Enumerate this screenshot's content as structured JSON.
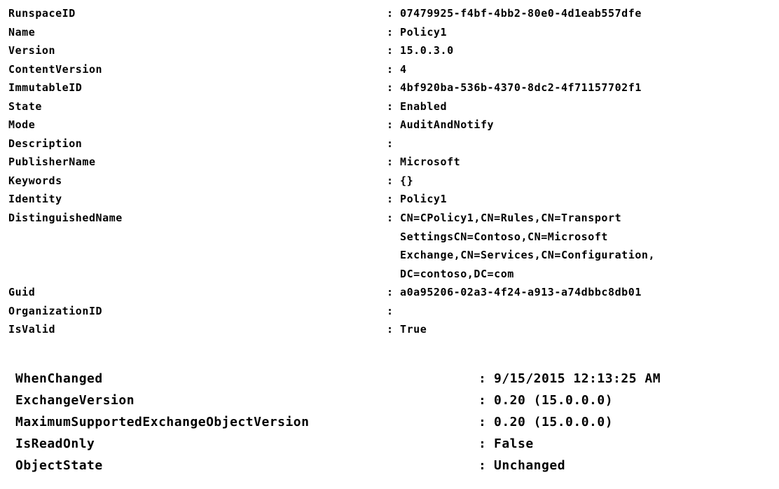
{
  "console": {
    "separator": ":",
    "foreground_color": "#000000",
    "background_color": "#ffffff",
    "blocks": [
      {
        "name": "policy-properties",
        "properties": [
          {
            "label": "RunspaceID",
            "value": "07479925-f4bf-4bb2-80e0-4d1eab557dfe"
          },
          {
            "label": "Name",
            "value": "Policy1"
          },
          {
            "label": "Version",
            "value": "15.0.3.0"
          },
          {
            "label": "ContentVersion",
            "value": "4"
          },
          {
            "label": "ImmutableID",
            "value": "4bf920ba-536b-4370-8dc2-4f71157702f1"
          },
          {
            "label": "State",
            "value": "Enabled"
          },
          {
            "label": "Mode",
            "value": "AuditAndNotify"
          },
          {
            "label": "Description",
            "value": ""
          },
          {
            "label": "PublisherName",
            "value": "Microsoft"
          },
          {
            "label": "Keywords",
            "value": "{}"
          },
          {
            "label": "Identity",
            "value": "Policy1"
          },
          {
            "label": "DistinguishedName",
            "value": "CN=CPolicy1,CN=Rules,CN=Transport SettingsCN=Contoso,CN=Microsoft Exchange,CN=Services,CN=Configuration, DC=contoso,DC=com",
            "value_lines": [
              "CN=CPolicy1,CN=Rules,CN=Transport",
              "SettingsCN=Contoso,CN=Microsoft",
              "Exchange,CN=Services,CN=Configuration,",
              "DC=contoso,DC=com"
            ]
          },
          {
            "label": "Guid",
            "value": "a0a95206-02a3-4f24-a913-a74dbbc8db01"
          },
          {
            "label": "OrganizationID",
            "value": ""
          },
          {
            "label": "IsValid",
            "value": "True"
          }
        ]
      },
      {
        "name": "object-metadata",
        "properties": [
          {
            "label": "WhenChanged",
            "value": "9/15/2015 12:13:25 AM"
          },
          {
            "label": "ExchangeVersion",
            "value": "0.20 (15.0.0.0)"
          },
          {
            "label": "MaximumSupportedExchangeObjectVersion",
            "value": "0.20 (15.0.0.0)"
          },
          {
            "label": "IsReadOnly",
            "value": "False"
          },
          {
            "label": "ObjectState",
            "value": "Unchanged"
          }
        ]
      }
    ]
  }
}
